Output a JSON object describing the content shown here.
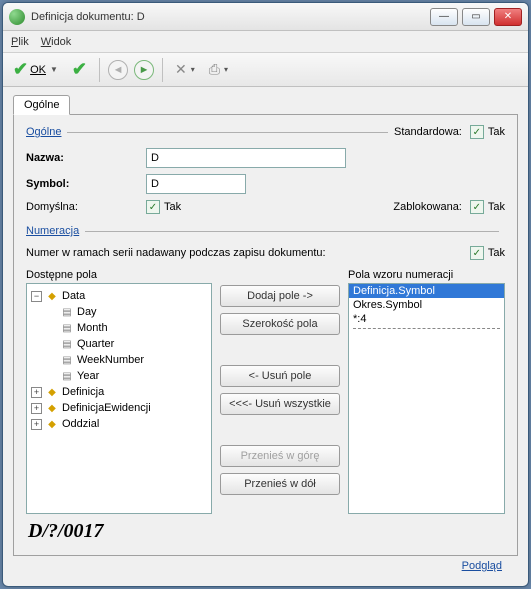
{
  "window": {
    "title": "Definicja dokumentu: D"
  },
  "menu": {
    "plik": "Plik",
    "widok": "Widok"
  },
  "toolbar": {
    "ok": "OK"
  },
  "tabs": {
    "ogolne": "Ogólne"
  },
  "section": {
    "ogolne": "Ogólne",
    "numeracja": "Numeracja"
  },
  "labels": {
    "standardowa": "Standardowa:",
    "nazwa": "Nazwa:",
    "symbol": "Symbol:",
    "domyslna": "Domyślna:",
    "zablokowana": "Zablokowana:",
    "tak": "Tak",
    "series_text": "Numer w ramach serii nadawany podczas zapisu dokumentu:",
    "dostepne_pola": "Dostępne pola",
    "pola_wzoru": "Pola wzoru numeracji"
  },
  "fields": {
    "nazwa_value": "D",
    "symbol_value": "D"
  },
  "tree": {
    "root": "Data",
    "children": [
      "Day",
      "Month",
      "Quarter",
      "WeekNumber",
      "Year"
    ],
    "siblings": [
      "Definicja",
      "DefinicjaEwidencji",
      "Oddzial"
    ]
  },
  "buttons": {
    "dodaj": "Dodaj pole ->",
    "szerokosc": "Szerokość pola",
    "usun": "<- Usuń pole",
    "usun_wszystkie": "<<<- Usuń wszystkie",
    "przenies_gore": "Przenieś w górę",
    "przenies_dol": "Przenieś w dół"
  },
  "pattern_list": {
    "items": [
      "Definicja.Symbol",
      "Okres.Symbol",
      "*:4"
    ],
    "selected_index": 0
  },
  "result": "D/?/0017",
  "footer": {
    "podglad": "Podgląd"
  }
}
